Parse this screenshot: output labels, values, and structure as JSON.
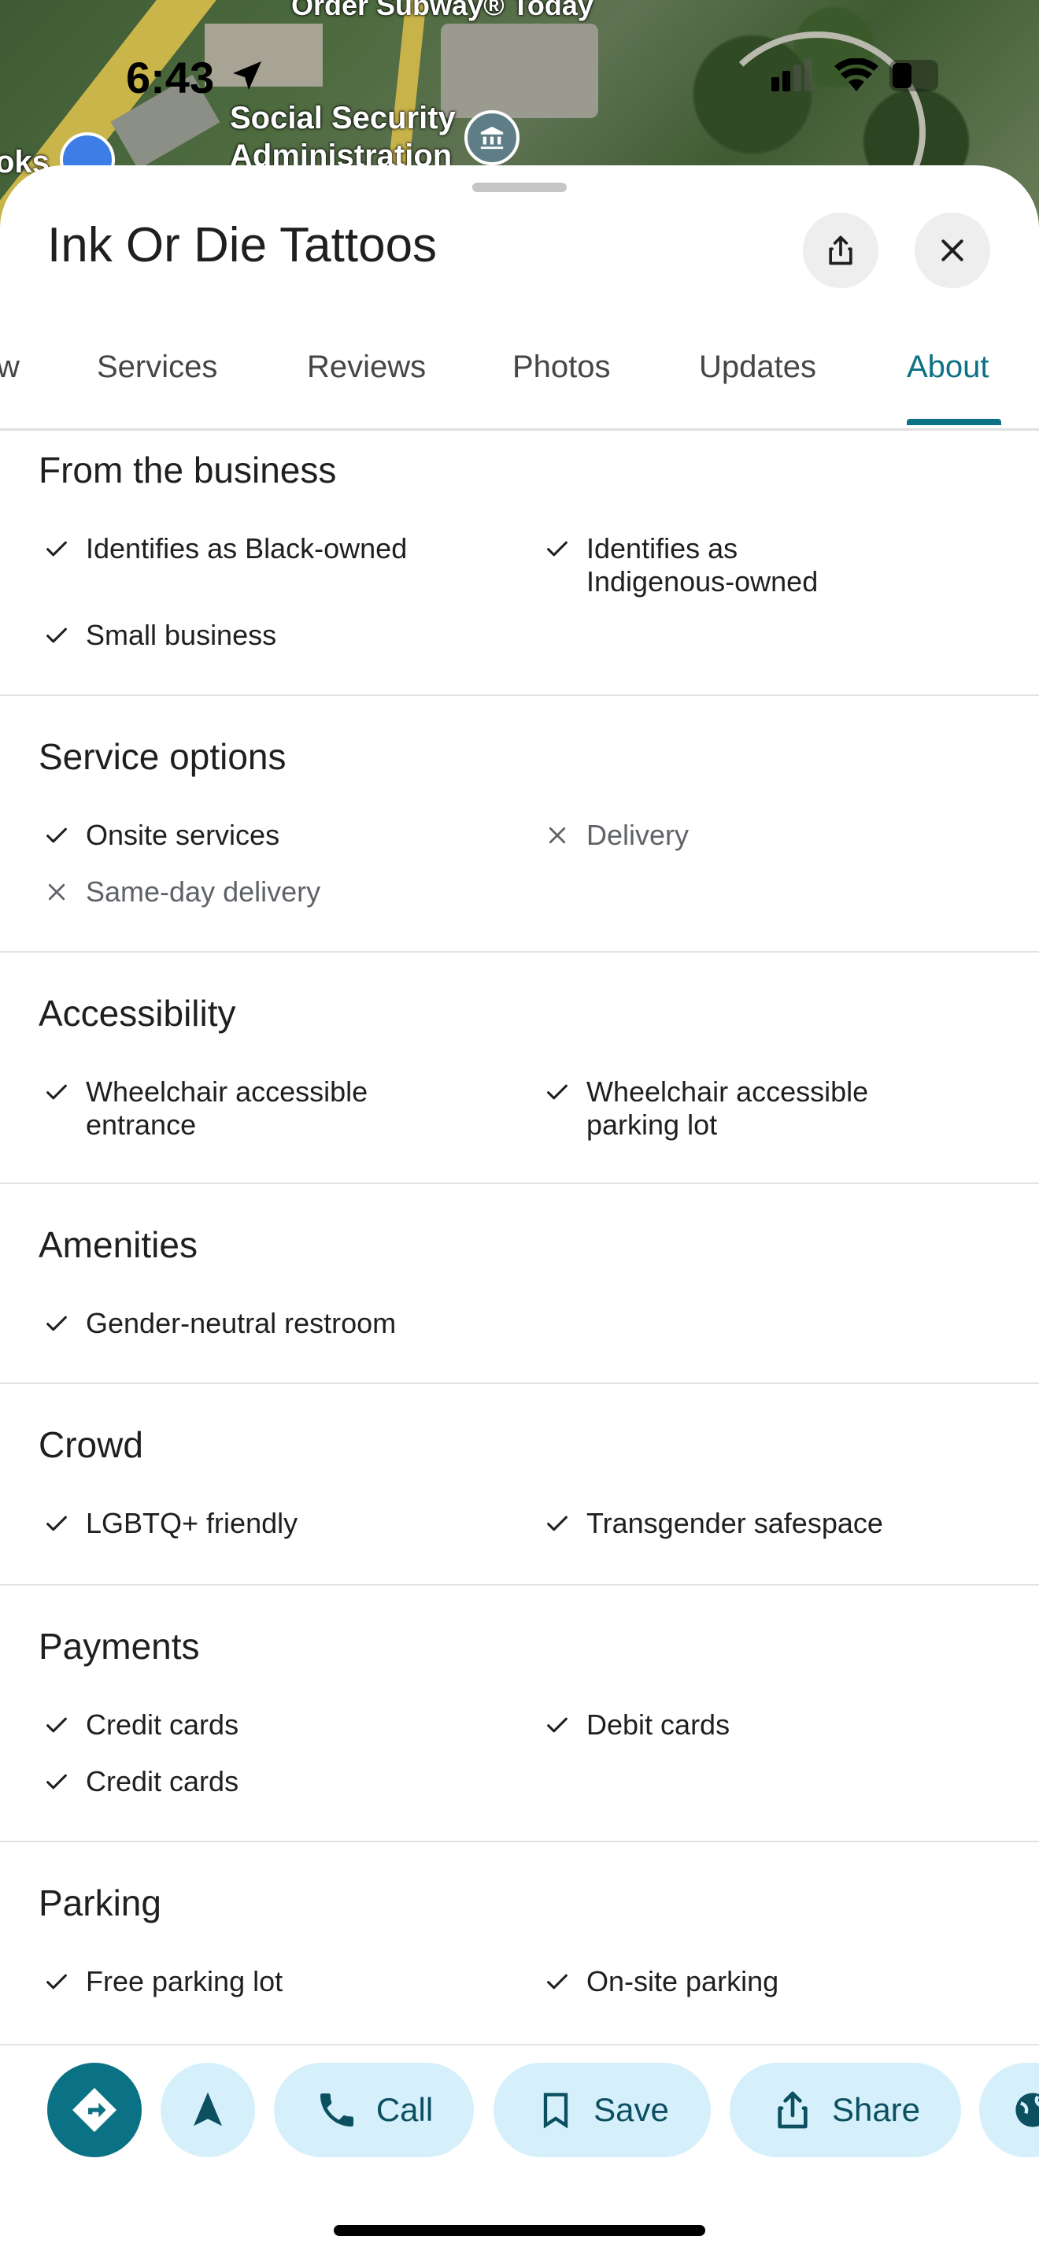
{
  "status_bar": {
    "time": "6:43",
    "icons": [
      "location-arrow-icon",
      "signal-icon",
      "wifi-icon",
      "battery-icon"
    ]
  },
  "map": {
    "labels": {
      "top": "Order Subway® Today",
      "poi1": "Social Security",
      "poi2": "Administration",
      "left": "oks"
    }
  },
  "place": {
    "title": "Ink Or Die Tattoos"
  },
  "tabs": [
    {
      "label": "w"
    },
    {
      "label": "Services"
    },
    {
      "label": "Reviews"
    },
    {
      "label": "Photos"
    },
    {
      "label": "Updates"
    },
    {
      "label": "About",
      "active": true
    }
  ],
  "sections": [
    {
      "title": "From the business",
      "items": [
        {
          "label": "Identifies as Black-owned",
          "available": true
        },
        {
          "label": "Identifies as Indigenous-owned",
          "available": true
        },
        {
          "label": "Small business",
          "available": true
        }
      ]
    },
    {
      "title": "Service options",
      "items": [
        {
          "label": "Onsite services",
          "available": true
        },
        {
          "label": "Delivery",
          "available": false
        },
        {
          "label": "Same-day delivery",
          "available": false
        }
      ]
    },
    {
      "title": "Accessibility",
      "items": [
        {
          "label": "Wheelchair accessible entrance",
          "available": true
        },
        {
          "label": "Wheelchair accessible parking lot",
          "available": true
        }
      ]
    },
    {
      "title": "Amenities",
      "items": [
        {
          "label": "Gender-neutral restroom",
          "available": true
        }
      ]
    },
    {
      "title": "Crowd",
      "items": [
        {
          "label": "LGBTQ+ friendly",
          "available": true
        },
        {
          "label": "Transgender safespace",
          "available": true
        }
      ]
    },
    {
      "title": "Payments",
      "items": [
        {
          "label": "Credit cards",
          "available": true
        },
        {
          "label": "Debit cards",
          "available": true
        },
        {
          "label": "Credit cards",
          "available": true
        }
      ]
    },
    {
      "title": "Parking",
      "items": [
        {
          "label": "Free parking lot",
          "available": true
        },
        {
          "label": "On-site parking",
          "available": true
        }
      ]
    }
  ],
  "actions": {
    "call": "Call",
    "save": "Save",
    "share": "Share"
  },
  "colors": {
    "accent": "#0b7285",
    "pill_bg": "#d6f0fb"
  }
}
